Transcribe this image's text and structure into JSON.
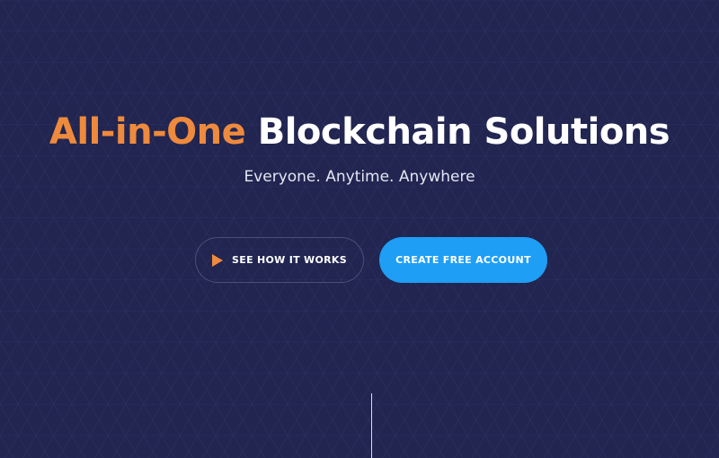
{
  "hero": {
    "title_accent": "All-in-One",
    "title_rest": "Blockchain Solutions",
    "subtitle": "Everyone. Anytime. Anywhere"
  },
  "buttons": {
    "see_how_label": "SEE HOW IT WORKS",
    "create_account_label": "CREATE FREE ACCOUNT"
  },
  "icons": {
    "play": "play-icon"
  },
  "colors": {
    "background": "#212550",
    "accent_orange": "#ee8a3d",
    "primary_blue": "#1e9ef4",
    "text_white": "#ffffff"
  }
}
